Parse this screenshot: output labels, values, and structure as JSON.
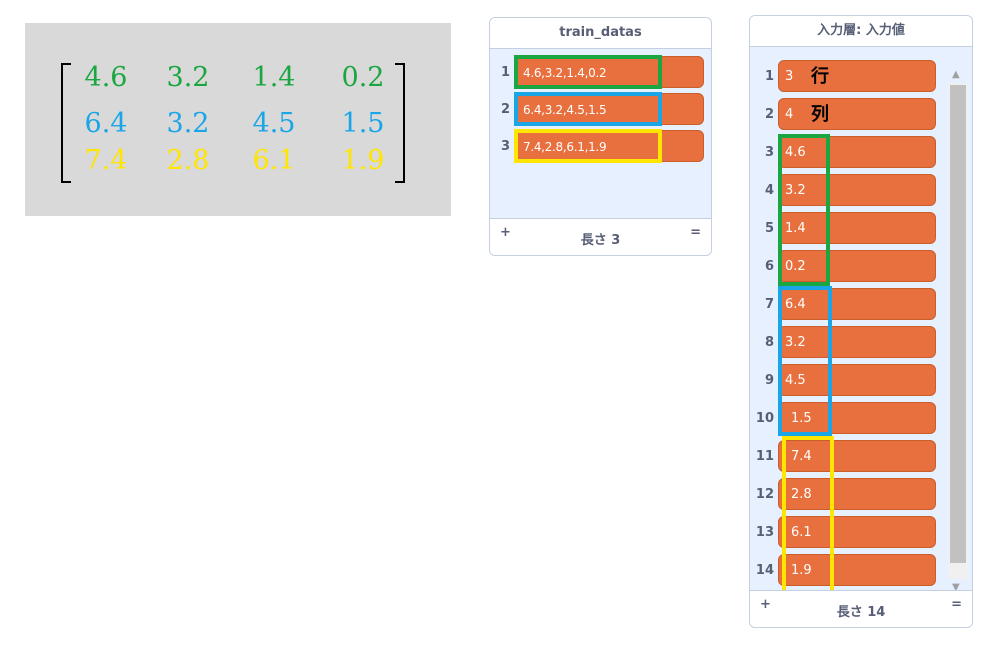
{
  "colors": {
    "green": "#1aa640",
    "blue": "#1aa6e6",
    "yellow": "#ffe500",
    "cell": "#e8703e"
  },
  "matrix": {
    "rows": [
      [
        "4.6",
        "3.2",
        "1.4",
        "0.2"
      ],
      [
        "6.4",
        "3.2",
        "4.5",
        "1.5"
      ],
      [
        "7.4",
        "2.8",
        "6.1",
        "1.9"
      ]
    ]
  },
  "train_monitor": {
    "title": "train_datas",
    "items": [
      {
        "index": "1",
        "value": "4.6,3.2,1.4,0.2"
      },
      {
        "index": "2",
        "value": "6.4,3.2,4.5,1.5"
      },
      {
        "index": "3",
        "value": "7.4,2.8,6.1,1.9"
      }
    ],
    "add_label": "+",
    "length_label": "長さ 3",
    "resize_label": "="
  },
  "input_monitor": {
    "title": "入力層: 入力値",
    "items": [
      {
        "index": "1",
        "value": "3",
        "annotation": "行"
      },
      {
        "index": "2",
        "value": "4",
        "annotation": "列"
      },
      {
        "index": "3",
        "value": "4.6"
      },
      {
        "index": "4",
        "value": "3.2"
      },
      {
        "index": "5",
        "value": "1.4"
      },
      {
        "index": "6",
        "value": "0.2"
      },
      {
        "index": "7",
        "value": "6.4"
      },
      {
        "index": "8",
        "value": "3.2"
      },
      {
        "index": "9",
        "value": "4.5"
      },
      {
        "index": "10",
        "value": "1.5"
      },
      {
        "index": "11",
        "value": "7.4"
      },
      {
        "index": "12",
        "value": "2.8"
      },
      {
        "index": "13",
        "value": "6.1"
      },
      {
        "index": "14",
        "value": "1.9"
      }
    ],
    "add_label": "+",
    "length_label": "長さ 14",
    "resize_label": "="
  }
}
